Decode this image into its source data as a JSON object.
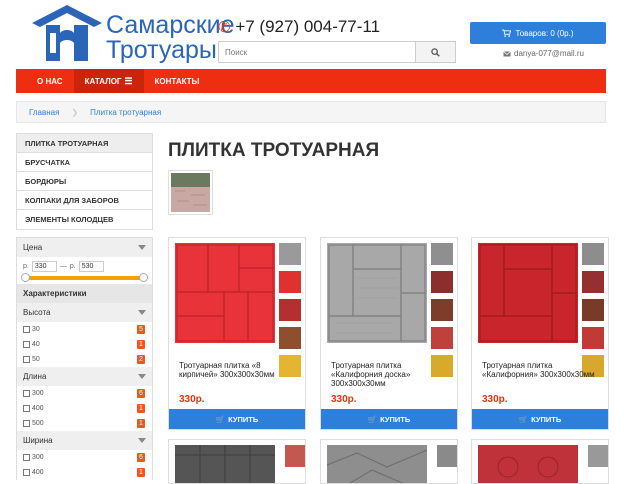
{
  "header": {
    "logo_line1": "Самарские",
    "logo_line2": "Тротуары",
    "phone": "+7 (927) 004-77-11",
    "search_placeholder": "Поиск",
    "cart_label": "Товаров: 0 (0р.)",
    "email": "danya-077@mail.ru"
  },
  "nav": {
    "items": [
      {
        "label": "О НАС"
      },
      {
        "label": "КАТАЛОГ"
      },
      {
        "label": "КОНТАКТЫ"
      }
    ]
  },
  "breadcrumb": {
    "items": [
      "Главная",
      "Плитка тротуарная"
    ]
  },
  "categories": [
    "ПЛИТКА ТРОТУАРНАЯ",
    "БРУСЧАТКА",
    "БОРДЮРЫ",
    "КОЛПАКИ ДЛЯ ЗАБОРОВ",
    "ЭЛЕМЕНТЫ КОЛОДЦЕВ"
  ],
  "filter": {
    "price": {
      "label": "Цена",
      "from_prefix": "р.",
      "from_value": "330",
      "dash": "—",
      "to_prefix": "р.",
      "to_value": "530"
    },
    "characteristics_label": "Характеристики",
    "groups": [
      {
        "label": "Высота",
        "options": [
          {
            "label": "30",
            "count": "5"
          },
          {
            "label": "40",
            "count": "1"
          },
          {
            "label": "50",
            "count": "2"
          }
        ]
      },
      {
        "label": "Длина",
        "options": [
          {
            "label": "300",
            "count": "6"
          },
          {
            "label": "400",
            "count": "1"
          },
          {
            "label": "500",
            "count": "1"
          }
        ]
      },
      {
        "label": "Ширина",
        "options": [
          {
            "label": "300",
            "count": "6"
          },
          {
            "label": "400",
            "count": "1"
          }
        ]
      }
    ]
  },
  "main": {
    "title": "ПЛИТКА ТРОТУАРНАЯ"
  },
  "products": [
    {
      "name": "Тротуарная плитка «8 кирпичей» 300х300х30мм",
      "price": "330р.",
      "buy": "КУПИТЬ"
    },
    {
      "name": "Тротуарная плитка «Калифорния доска» 300х300х30мм",
      "price": "330р.",
      "buy": "КУПИТЬ"
    },
    {
      "name": "Тротуарная плитка «Калифорния» 300х300х30мм",
      "price": "330р.",
      "buy": "КУПИТЬ"
    }
  ],
  "colors": {
    "accent_red": "#ee2e10",
    "accent_blue": "#2d7fd9",
    "price_red": "#ee2e10",
    "slider_orange": "#f4a000",
    "count_badge": "#ee5522"
  },
  "icons": [
    "logo-house-icon",
    "phone-icon",
    "search-icon",
    "cart-icon",
    "mail-icon",
    "menu-icon",
    "chevron-down-icon",
    "checkbox-icon"
  ]
}
